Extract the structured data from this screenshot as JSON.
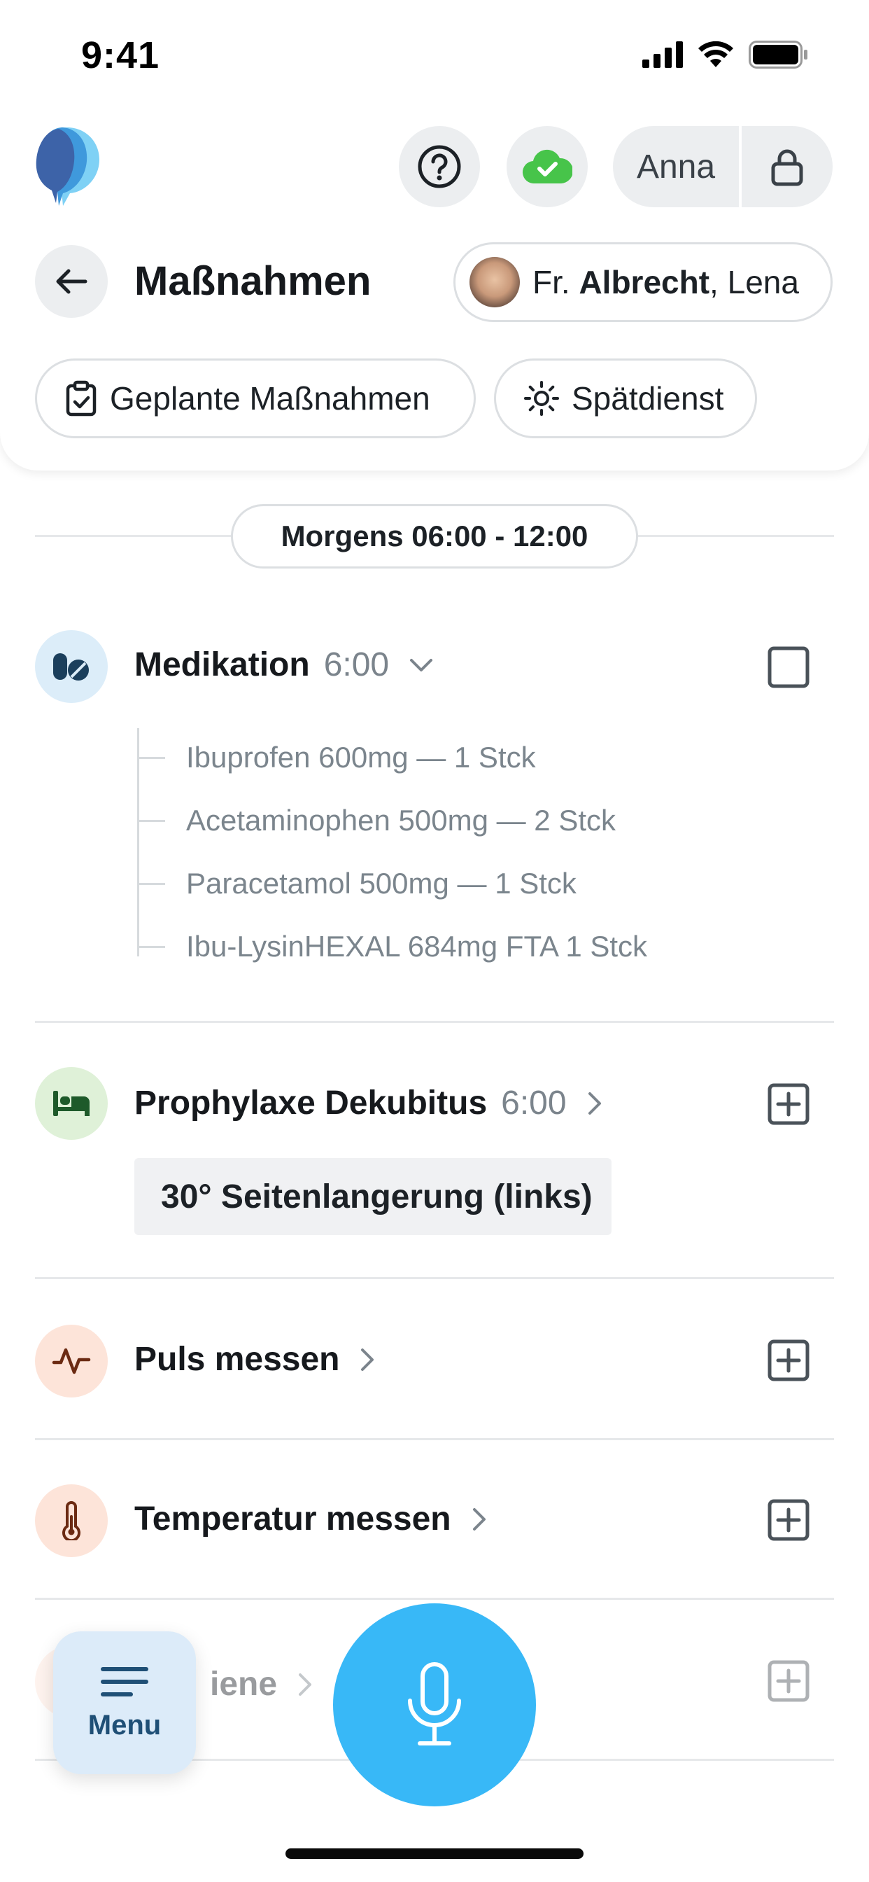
{
  "status_bar": {
    "time": "9:41"
  },
  "header": {
    "user_name": "Anna",
    "title": "Maßnahmen",
    "patient": {
      "salutation": "Fr.",
      "last_name": "Albrecht",
      "separator": ",",
      "first_name": "Lena"
    }
  },
  "filters": {
    "planned_label": "Geplante Maßnahmen",
    "shift_label": "Spätdienst"
  },
  "period": {
    "label": "Morgens 06:00 - 12:00"
  },
  "tasks": [
    {
      "title": "Medikation",
      "time": "6:00",
      "icon": "pills-icon",
      "color": "#dcedf9",
      "items": [
        "Ibuprofen 600mg — 1 Stck",
        "Acetaminophen 500mg — 2 Stck",
        "Paracetamol 500mg — 1 Stck",
        "Ibu-LysinHEXAL 684mg FTA 1 Stck"
      ]
    },
    {
      "title": "Prophylaxe Dekubitus",
      "time": "6:00",
      "icon": "bed-icon",
      "color": "#dff1d8",
      "tag": "30° Seitenlangerung (links)"
    },
    {
      "title": "Puls messen",
      "icon": "pulse-icon",
      "color": "#fde4d9"
    },
    {
      "title": "Temperatur messen",
      "icon": "thermometer-icon",
      "color": "#fde4d9"
    },
    {
      "title": "iene",
      "icon": "hygiene-icon",
      "color": "#fde4d9"
    }
  ],
  "bottom": {
    "menu_label": "Menu"
  },
  "colors": {
    "accent": "#38b8f7",
    "cloud_ok": "#47c44a"
  }
}
